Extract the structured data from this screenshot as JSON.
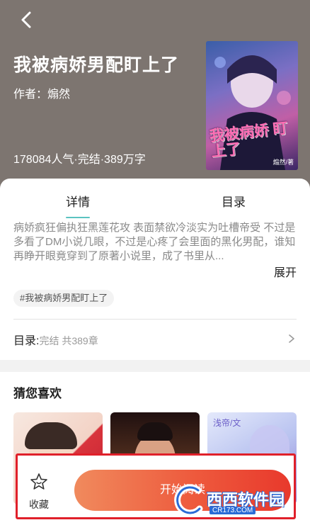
{
  "header": {
    "title": "我被病娇男配盯上了",
    "author": "作者：煽然",
    "stats": "178084人气·完结·389万字"
  },
  "cover": {
    "title": "我被病娇 盯上了",
    "badge": "男配",
    "author": "煽然/著"
  },
  "tabs": [
    {
      "label": "详情"
    },
    {
      "label": "目录"
    }
  ],
  "detail": {
    "description": "病娇疯狂偏执狂黑莲花攻 表面禁欲冷淡实为吐槽帝受 不过是多看了DM小说几眼，不过是心疼了会里面的黑化男配，谁知再睁开眼竟穿到了原著小说里，成了书里从...",
    "expand_label": "展开",
    "tag": "#我被病娇男配盯上了",
    "toc_label": "目录:",
    "toc_meta": "完结 共389章"
  },
  "recommendations": {
    "title": "猜您喜欢",
    "items": [
      {
        "cover_text": ""
      },
      {
        "cover_text": ""
      },
      {
        "cover_text": "浅帝/文"
      }
    ]
  },
  "bottom_bar": {
    "favorite_label": "收藏",
    "read_label": "开始阅读"
  },
  "watermark": {
    "text": "西西软件园",
    "url": "CR173.COM"
  },
  "colors": {
    "header_bg": "#7d7570",
    "accent_teal": "#5bc3c0",
    "read_button": "#e8392c",
    "highlight_border": "#e0202a"
  },
  "icons": {
    "back": "back-arrow-icon",
    "chevron": "chevron-right-icon",
    "favorite": "star-icon"
  }
}
